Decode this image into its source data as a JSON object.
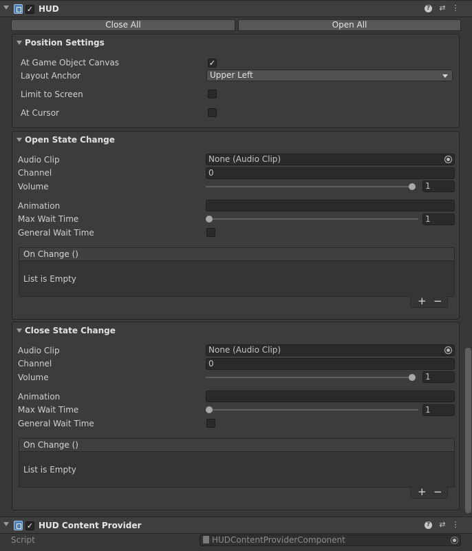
{
  "hud": {
    "title": "HUD",
    "enabled_check": "✓",
    "close_all": "Close All",
    "open_all": "Open All"
  },
  "position": {
    "title": "Position Settings",
    "at_game_object_canvas": "At Game Object Canvas",
    "at_game_object_canvas_check": "✓",
    "layout_anchor": "Layout Anchor",
    "layout_anchor_value": "Upper Left",
    "limit_to_screen": "Limit to Screen",
    "at_cursor": "At Cursor"
  },
  "open_state": {
    "title": "Open State Change",
    "audio_clip": "Audio Clip",
    "audio_clip_value": "None (Audio Clip)",
    "channel": "Channel",
    "channel_value": "0",
    "volume": "Volume",
    "volume_value": "1",
    "volume_fraction": 1.0,
    "animation": "Animation",
    "max_wait_time": "Max Wait Time",
    "max_wait_time_value": "1",
    "max_wait_fraction": 0.0,
    "general_wait_time": "General Wait Time",
    "on_change": "On Change ()",
    "list_empty": "List is Empty",
    "plus": "+",
    "minus": "−"
  },
  "close_state": {
    "title": "Close State Change",
    "audio_clip": "Audio Clip",
    "audio_clip_value": "None (Audio Clip)",
    "channel": "Channel",
    "channel_value": "0",
    "volume": "Volume",
    "volume_value": "1",
    "volume_fraction": 1.0,
    "animation": "Animation",
    "max_wait_time": "Max Wait Time",
    "max_wait_time_value": "1",
    "max_wait_fraction": 0.0,
    "general_wait_time": "General Wait Time",
    "on_change": "On Change ()",
    "list_empty": "List is Empty",
    "plus": "+",
    "minus": "−"
  },
  "hud_content": {
    "title": "HUD Content Provider",
    "enabled_check": "✓",
    "script_label": "Script",
    "script_value": "HUDContentProviderComponent"
  },
  "icons": [
    "fold-arrow-icon",
    "script-icon",
    "help-icon",
    "presets-icon",
    "kebab-menu-icon",
    "object-picker-icon",
    "dropdown-caret-icon"
  ],
  "colors": {
    "background": "#383838",
    "panel": "#3c3c3c",
    "header": "#3e3e3e",
    "field": "#2a2a2a",
    "button": "#585858"
  }
}
